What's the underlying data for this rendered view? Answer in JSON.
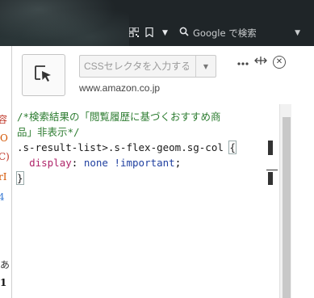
{
  "browser": {
    "search_placeholder": "Google で検索",
    "icons": [
      "qr-code-icon",
      "bookmark-icon",
      "chevron-down-icon",
      "search-icon",
      "chevron-down-icon"
    ]
  },
  "background_page": {
    "fragments": [
      "容",
      "O",
      "C)",
      "rI",
      "4",
      "あ",
      "1"
    ]
  },
  "panel": {
    "selector_placeholder": "CSSセレクタを入力する...",
    "domain": "www.amazon.co.jp",
    "icons": [
      "element-picker-icon",
      "more-options-icon",
      "resize-arrows-icon",
      "close-icon"
    ]
  },
  "editor": {
    "lines": [
      "/*検索結果の「閲覧履歴に基づくおすすめ商",
      "品」非表示*/",
      ".s-result-list>.s-flex-geom.sg-col ",
      "{",
      "  display: none !important;",
      "}"
    ],
    "tokens": {
      "comment1": "/*検索結果の「閲覧履歴に基づくおすすめ商",
      "comment2": "品」非表示*/",
      "selector": ".s-result-list>.s-flex-geom.sg-col ",
      "open_brace": "{",
      "indent": "  ",
      "prop": "display",
      "colon": ": ",
      "value": "none",
      "space": " ",
      "important": "!important",
      "semicolon": ";",
      "close_brace": "}"
    }
  },
  "colors": {
    "comment": "#2e7d32",
    "property": "#b0256a",
    "value": "#2040a0",
    "topbar": "#1f2528"
  }
}
